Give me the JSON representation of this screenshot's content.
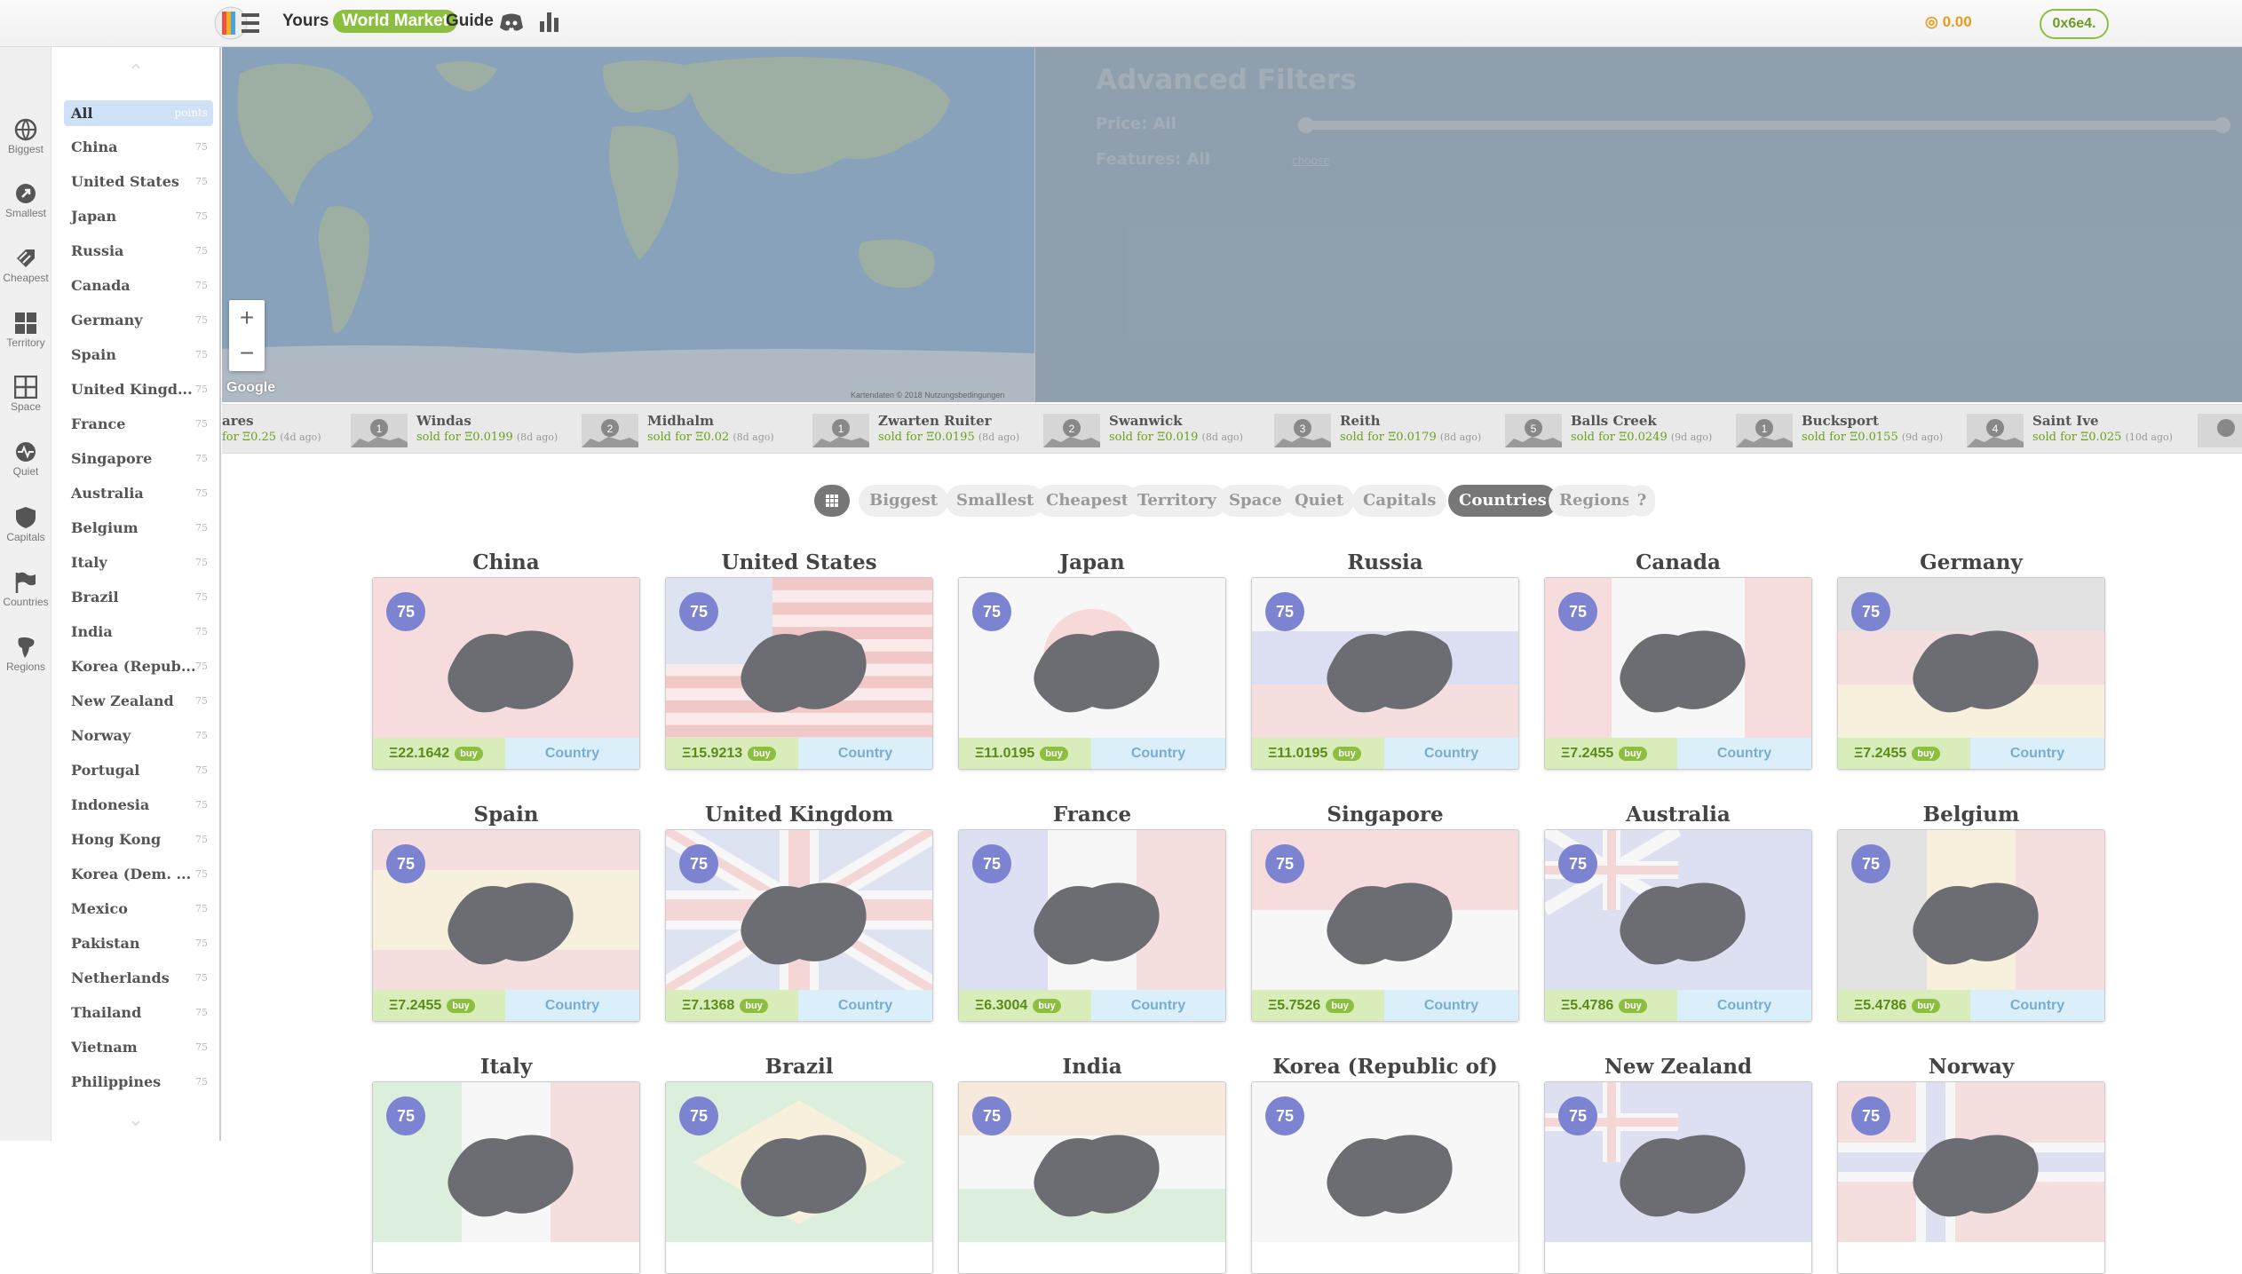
{
  "nav": {
    "yours": "Yours",
    "world_market": "World Market",
    "guide": "Guide",
    "discord_icon": "discord-icon",
    "stats_icon": "bar-chart-icon"
  },
  "wallet": {
    "balance": "0.00",
    "address": "0x6e4."
  },
  "rail": [
    {
      "label": "Biggest",
      "icon": "globe-icon"
    },
    {
      "label": "Smallest",
      "icon": "pin-icon"
    },
    {
      "label": "Cheapest",
      "icon": "tag-icon"
    },
    {
      "label": "Territory",
      "icon": "grid-icon"
    },
    {
      "label": "Space",
      "icon": "squares-icon"
    },
    {
      "label": "Quiet",
      "icon": "pulse-icon"
    },
    {
      "label": "Capitals",
      "icon": "shield-icon"
    },
    {
      "label": "Countries",
      "icon": "flag-icon"
    },
    {
      "label": "Regions",
      "icon": "continent-icon"
    }
  ],
  "categories": [
    {
      "name": "All",
      "count": "points"
    },
    {
      "name": "China",
      "count": "75"
    },
    {
      "name": "United States",
      "count": "75"
    },
    {
      "name": "Japan",
      "count": "75"
    },
    {
      "name": "Russia",
      "count": "75"
    },
    {
      "name": "Canada",
      "count": "75"
    },
    {
      "name": "Germany",
      "count": "75"
    },
    {
      "name": "Spain",
      "count": "75"
    },
    {
      "name": "United Kingd...",
      "count": "75"
    },
    {
      "name": "France",
      "count": "75"
    },
    {
      "name": "Singapore",
      "count": "75"
    },
    {
      "name": "Australia",
      "count": "75"
    },
    {
      "name": "Belgium",
      "count": "75"
    },
    {
      "name": "Italy",
      "count": "75"
    },
    {
      "name": "Brazil",
      "count": "75"
    },
    {
      "name": "India",
      "count": "75"
    },
    {
      "name": "Korea (Repub...",
      "count": "75"
    },
    {
      "name": "New Zealand",
      "count": "75"
    },
    {
      "name": "Norway",
      "count": "75"
    },
    {
      "name": "Portugal",
      "count": "75"
    },
    {
      "name": "Indonesia",
      "count": "75"
    },
    {
      "name": "Hong Kong",
      "count": "75"
    },
    {
      "name": "Korea (Dem. ...",
      "count": "75"
    },
    {
      "name": "Mexico",
      "count": "75"
    },
    {
      "name": "Pakistan",
      "count": "75"
    },
    {
      "name": "Netherlands",
      "count": "75"
    },
    {
      "name": "Thailand",
      "count": "75"
    },
    {
      "name": "Vietnam",
      "count": "75"
    },
    {
      "name": "Philippines",
      "count": "75"
    }
  ],
  "map": {
    "zoom_in": "+",
    "zoom_out": "−",
    "google": "Google",
    "copyright": "Kartendaten © 2018   Nutzungsbedingungen"
  },
  "filters": {
    "title": "Advanced Filters",
    "price": "Price: All",
    "features": "Features: All",
    "choose": "choose"
  },
  "ticker": [
    {
      "name": "",
      "sold": "ares",
      "sold2": "for Ξ0.25",
      "ago": "(4d ago)",
      "rank": ""
    },
    {
      "name": "Windas",
      "sold": "sold for Ξ0.0199",
      "ago": "(8d ago)",
      "rank": "1"
    },
    {
      "name": "Midhalm",
      "sold": "sold for Ξ0.02",
      "ago": "(8d ago)",
      "rank": "2"
    },
    {
      "name": "Zwarten Ruiter",
      "sold": "sold for Ξ0.0195",
      "ago": "(8d ago)",
      "rank": "1"
    },
    {
      "name": "Swanwick",
      "sold": "sold for Ξ0.019",
      "ago": "(8d ago)",
      "rank": "2"
    },
    {
      "name": "Reith",
      "sold": "sold for Ξ0.0179",
      "ago": "(8d ago)",
      "rank": "3"
    },
    {
      "name": "Balls Creek",
      "sold": "sold for Ξ0.0249",
      "ago": "(9d ago)",
      "rank": "5"
    },
    {
      "name": "Bucksport",
      "sold": "sold for Ξ0.0155",
      "ago": "(9d ago)",
      "rank": "1"
    },
    {
      "name": "Saint Ive",
      "sold": "sold for Ξ0.025",
      "ago": "(10d ago)",
      "rank": "4"
    }
  ],
  "filterbar": [
    "Biggest",
    "Smallest",
    "Cheapest",
    "Territory",
    "Space",
    "Quiet",
    "Capitals",
    "Countries",
    "Regions",
    "?"
  ],
  "cards": [
    {
      "title": "China",
      "points": "75",
      "price": "Ξ22.1642",
      "buy": "buy",
      "type": "Country",
      "flag": "china"
    },
    {
      "title": "United States",
      "points": "75",
      "price": "Ξ15.9213",
      "buy": "buy",
      "type": "Country",
      "flag": "usa"
    },
    {
      "title": "Japan",
      "points": "75",
      "price": "Ξ11.0195",
      "buy": "buy",
      "type": "Country",
      "flag": "japan"
    },
    {
      "title": "Russia",
      "points": "75",
      "price": "Ξ11.0195",
      "buy": "buy",
      "type": "Country",
      "flag": "russia"
    },
    {
      "title": "Canada",
      "points": "75",
      "price": "Ξ7.2455",
      "buy": "buy",
      "type": "Country",
      "flag": "canada"
    },
    {
      "title": "Germany",
      "points": "75",
      "price": "Ξ7.2455",
      "buy": "buy",
      "type": "Country",
      "flag": "germany"
    },
    {
      "title": "Spain",
      "points": "75",
      "price": "Ξ7.2455",
      "buy": "buy",
      "type": "Country",
      "flag": "spain"
    },
    {
      "title": "United Kingdom",
      "points": "75",
      "price": "Ξ7.1368",
      "buy": "buy",
      "type": "Country",
      "flag": "uk"
    },
    {
      "title": "France",
      "points": "75",
      "price": "Ξ6.3004",
      "buy": "buy",
      "type": "Country",
      "flag": "france"
    },
    {
      "title": "Singapore",
      "points": "75",
      "price": "Ξ5.7526",
      "buy": "buy",
      "type": "Country",
      "flag": "singapore"
    },
    {
      "title": "Australia",
      "points": "75",
      "price": "Ξ5.4786",
      "buy": "buy",
      "type": "Country",
      "flag": "australia"
    },
    {
      "title": "Belgium",
      "points": "75",
      "price": "Ξ5.4786",
      "buy": "buy",
      "type": "Country",
      "flag": "belgium"
    },
    {
      "title": "Italy",
      "points": "75",
      "price": "",
      "buy": "",
      "type": "",
      "flag": "italy"
    },
    {
      "title": "Brazil",
      "points": "75",
      "price": "",
      "buy": "",
      "type": "",
      "flag": "brazil"
    },
    {
      "title": "India",
      "points": "75",
      "price": "",
      "buy": "",
      "type": "",
      "flag": "india"
    },
    {
      "title": "Korea (Republic of)",
      "points": "75",
      "price": "",
      "buy": "",
      "type": "",
      "flag": "korea"
    },
    {
      "title": "New Zealand",
      "points": "75",
      "price": "",
      "buy": "",
      "type": "",
      "flag": "nz"
    },
    {
      "title": "Norway",
      "points": "75",
      "price": "",
      "buy": "",
      "type": "",
      "flag": "norway"
    }
  ]
}
